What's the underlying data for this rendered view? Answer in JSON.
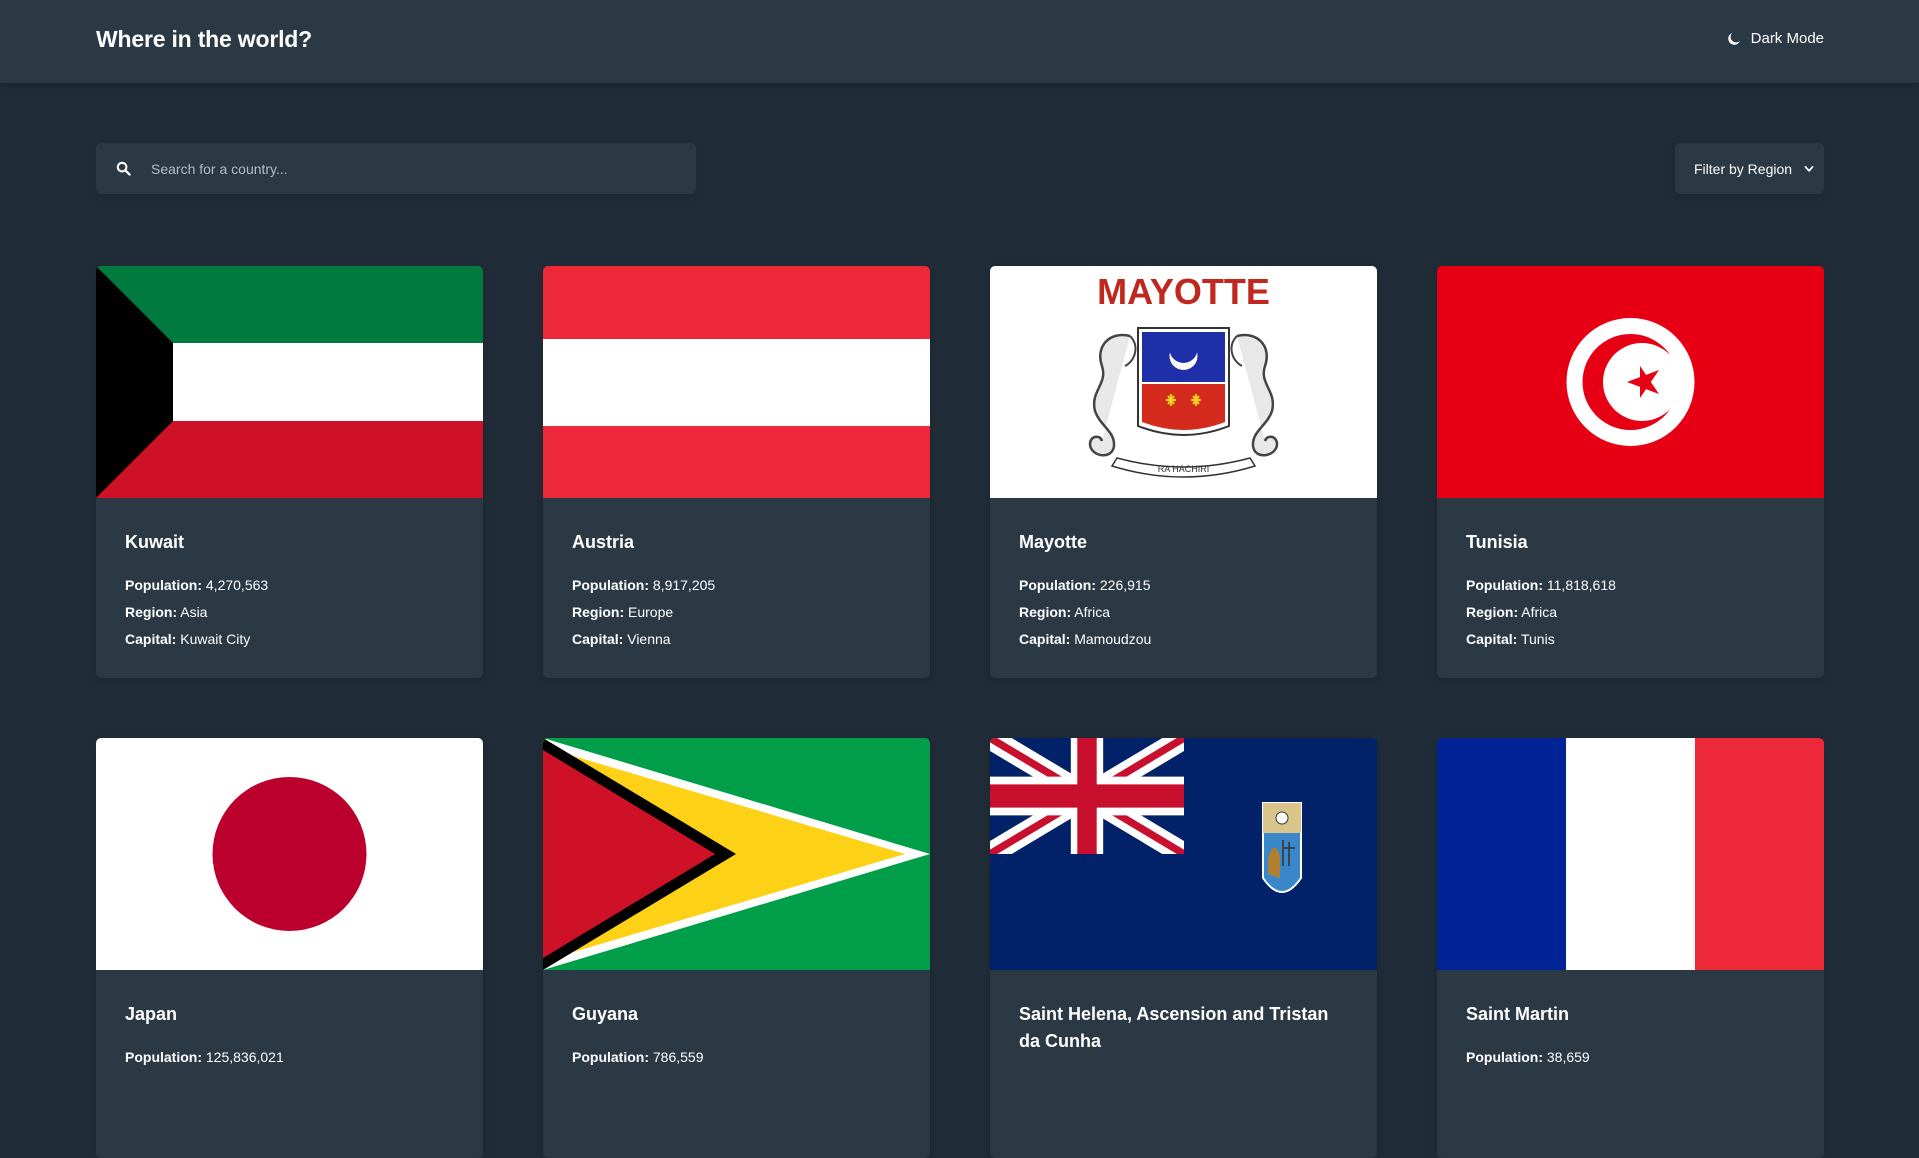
{
  "header": {
    "title": "Where in the world?",
    "theme_toggle_label": "Dark Mode"
  },
  "search": {
    "placeholder": "Search for a country..."
  },
  "filter": {
    "label": "Filter by Region"
  },
  "labels": {
    "population": "Population:",
    "region": "Region:",
    "capital": "Capital:"
  },
  "countries": [
    {
      "name": "Kuwait",
      "population": "4,270,563",
      "region": "Asia",
      "capital": "Kuwait City",
      "flag": "kuwait-flag"
    },
    {
      "name": "Austria",
      "population": "8,917,205",
      "region": "Europe",
      "capital": "Vienna",
      "flag": "austria-flag"
    },
    {
      "name": "Mayotte",
      "population": "226,915",
      "region": "Africa",
      "capital": "Mamoudzou",
      "flag": "mayotte-flag",
      "flag_text": "MAYOTTE",
      "flag_motto": "RA HACHIRI"
    },
    {
      "name": "Tunisia",
      "population": "11,818,618",
      "region": "Africa",
      "capital": "Tunis",
      "flag": "tunisia-flag"
    },
    {
      "name": "Japan",
      "population": "125,836,021",
      "flag": "japan-flag"
    },
    {
      "name": "Guyana",
      "population": "786,559",
      "flag": "guyana-flag"
    },
    {
      "name": "Saint Helena, Ascension and Tristan da Cunha",
      "flag": "saint-helena-flag"
    },
    {
      "name": "Saint Martin",
      "population": "38,659",
      "flag": "saint-martin-flag"
    }
  ],
  "colors": {
    "background": "#202c37",
    "surface": "#2b3945",
    "text": "#ffffff"
  }
}
